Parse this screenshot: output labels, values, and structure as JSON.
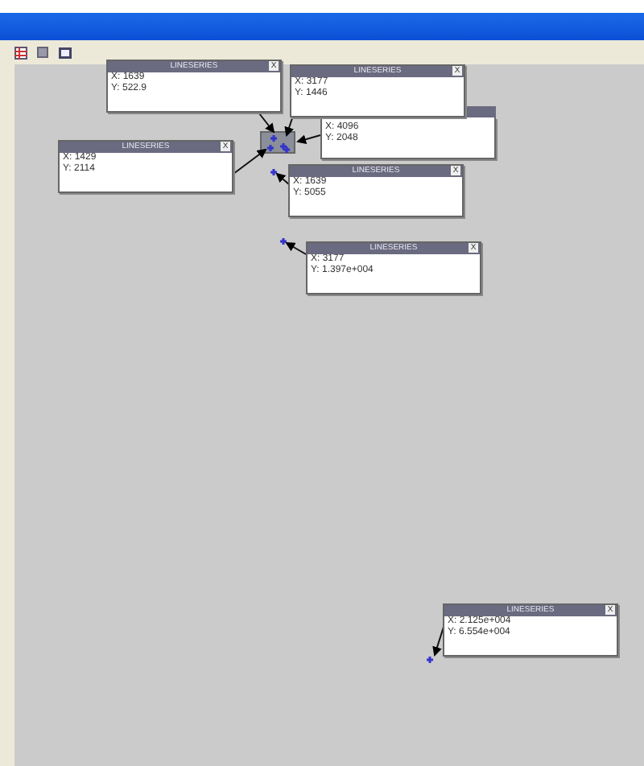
{
  "datatips": [
    {
      "x": "X: 4096",
      "y": "Y: 2048"
    },
    {
      "title": "LINESERIES",
      "close": "X",
      "x": "X: 1639",
      "y": "Y: 522.9"
    },
    {
      "title": "LINESERIES",
      "close": "X",
      "x": "X: 3177",
      "y": "Y: 1446"
    },
    {
      "title": "LINESERIES",
      "close": "X",
      "x": "X: 1429",
      "y": "Y: 2114"
    },
    {
      "title": "LINESERIES",
      "close": "X",
      "x": "X: 1639",
      "y": "Y: 5055"
    },
    {
      "title": "LINESERIES",
      "close": "X",
      "x": "X: 3177",
      "y": "Y: 1.397e+004"
    },
    {
      "title": "LINESERIES",
      "close": "X",
      "x": "X: 2.125e+004",
      "y": "Y: 6.554e+004"
    }
  ]
}
